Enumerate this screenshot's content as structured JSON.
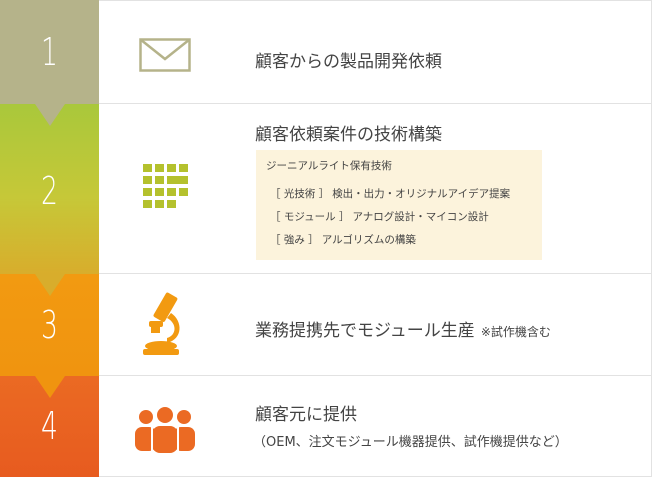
{
  "colors": {
    "step1": "#b5b38a",
    "step2_top": "#a9c83b",
    "step2_bottom": "#d8ad2c",
    "step3": "#f29a11",
    "step4": "#eb6a23",
    "tech_box_bg": "#fcf3dc",
    "text": "#444444"
  },
  "steps": [
    {
      "number": "1",
      "icon": "envelope-icon",
      "title": "顧客からの製品開発依頼"
    },
    {
      "number": "2",
      "icon": "grid-icon",
      "title": "顧客依頼案件の技術構築",
      "tech_box": {
        "heading": "ジーニアルライト保有技術",
        "items": [
          {
            "tag": "［ 光技術 ］",
            "text": "検出・出力・オリジナルアイデア提案"
          },
          {
            "tag": "［ モジュール ］",
            "text": "アナログ設計・マイコン設計"
          },
          {
            "tag": "［ 強み ］",
            "text": "アルゴリズムの構築"
          }
        ]
      }
    },
    {
      "number": "3",
      "icon": "microscope-icon",
      "title": "業務提携先でモジュール生産",
      "note": "※試作機含む"
    },
    {
      "number": "4",
      "icon": "team-icon",
      "title": "顧客元に提供",
      "subtitle": "（OEM、注文モジュール機器提供、試作機提供など）"
    }
  ]
}
